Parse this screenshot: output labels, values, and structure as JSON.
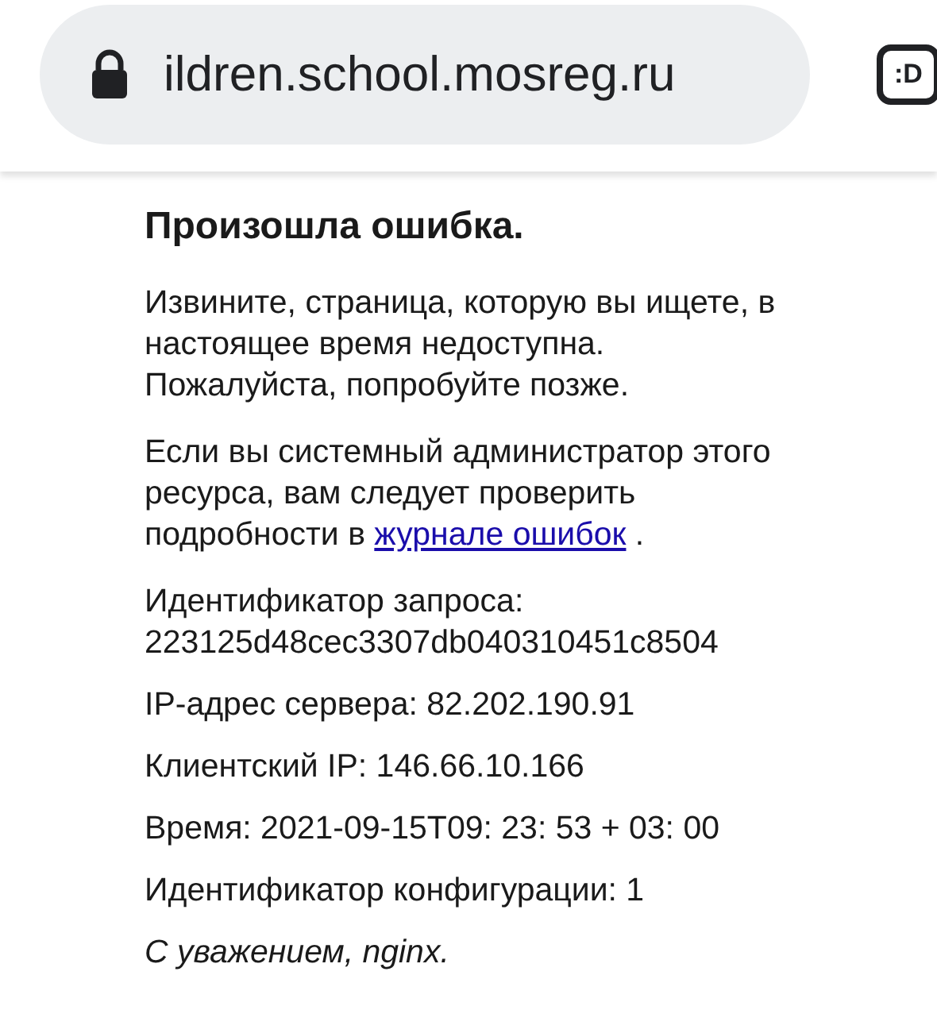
{
  "browser": {
    "url": "ildren.school.mosreg.ru",
    "secure": true,
    "tab_badge": ":D"
  },
  "page": {
    "title": "Произошла ошибка.",
    "paragraphs": [
      {
        "text": "Извините, страница, которую вы ищете, в настоящее время недоступна. Пожалуйста, попробуйте позже."
      },
      {
        "text": "Если вы системный администратор этого ресурса, вам следует проверить подробности в",
        "link": "журнале ошибок",
        "after": " ."
      }
    ],
    "details": [
      "Идентификатор запроса: 223125d48cec3307db040310451c8504",
      "IP-адрес сервера: 82.202.190.91",
      "Клиентский IP: 146.66.10.166",
      "Время: 2021-09-15T09: 23: 53 + 03: 00",
      "Идентификатор конфигурации: 1"
    ],
    "signature": "С уважением, nginx."
  }
}
